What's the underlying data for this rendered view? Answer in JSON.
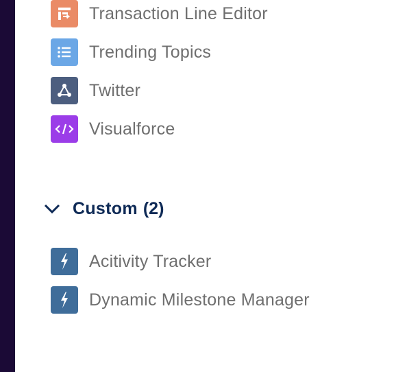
{
  "colors": {
    "sidebar_strip": "#1b0a36",
    "label_text": "#6f6f6f",
    "section_title": "#0e2a56"
  },
  "standard_items": [
    {
      "label": "Transaction Line Editor",
      "icon": "transaction-line-editor-icon",
      "tile_color": "#ea8b66"
    },
    {
      "label": "Trending Topics",
      "icon": "list-icon",
      "tile_color": "#6ba7e6"
    },
    {
      "label": "Twitter",
      "icon": "network-graph-icon",
      "tile_color": "#4c5e7f"
    },
    {
      "label": "Visualforce",
      "icon": "code-icon",
      "tile_color": "#9b3de8"
    }
  ],
  "custom_section": {
    "title": "Custom",
    "count": "(2)",
    "expanded": true,
    "icon": "chevron-down-icon"
  },
  "custom_items": [
    {
      "label": "Acitivity Tracker",
      "icon": "lightning-bolt-icon",
      "tile_color": "#3f6d9a"
    },
    {
      "label": "Dynamic Milestone Manager",
      "icon": "lightning-bolt-icon",
      "tile_color": "#3f6d9a"
    }
  ]
}
